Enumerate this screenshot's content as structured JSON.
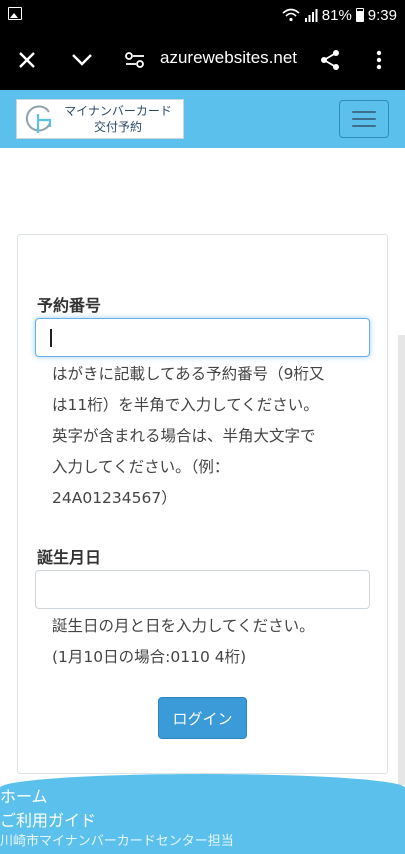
{
  "status_bar": {
    "battery": "81%",
    "time": "9:39"
  },
  "browser": {
    "url": "azurewebsites.net"
  },
  "header": {
    "logo_line1": "マイナンバーカード",
    "logo_line2": "交付予約"
  },
  "form": {
    "reservation": {
      "label": "予約番号",
      "value": "",
      "help_lines": [
        "はがきに記載してある予約番号（9桁又",
        "は11桁）を半角で入力してください。",
        "英字が含まれる場合は、半角大文字で",
        "入力してください。（例：",
        "24A01234567）"
      ]
    },
    "birthday": {
      "label": "誕生月日",
      "value": "",
      "help_lines": [
        "誕生日の月と日を入力してください。",
        "(1月10日の場合:0110 4桁)"
      ]
    },
    "login_label": "ログイン"
  },
  "footer": {
    "home": "ホーム",
    "guide": "ご利用ガイド",
    "credit": "川崎市マイナンバーカードセンター担当"
  },
  "colors": {
    "header_bg": "#5bc0eb",
    "button_bg": "#3a9bd8",
    "focus_border": "#66afe9"
  }
}
